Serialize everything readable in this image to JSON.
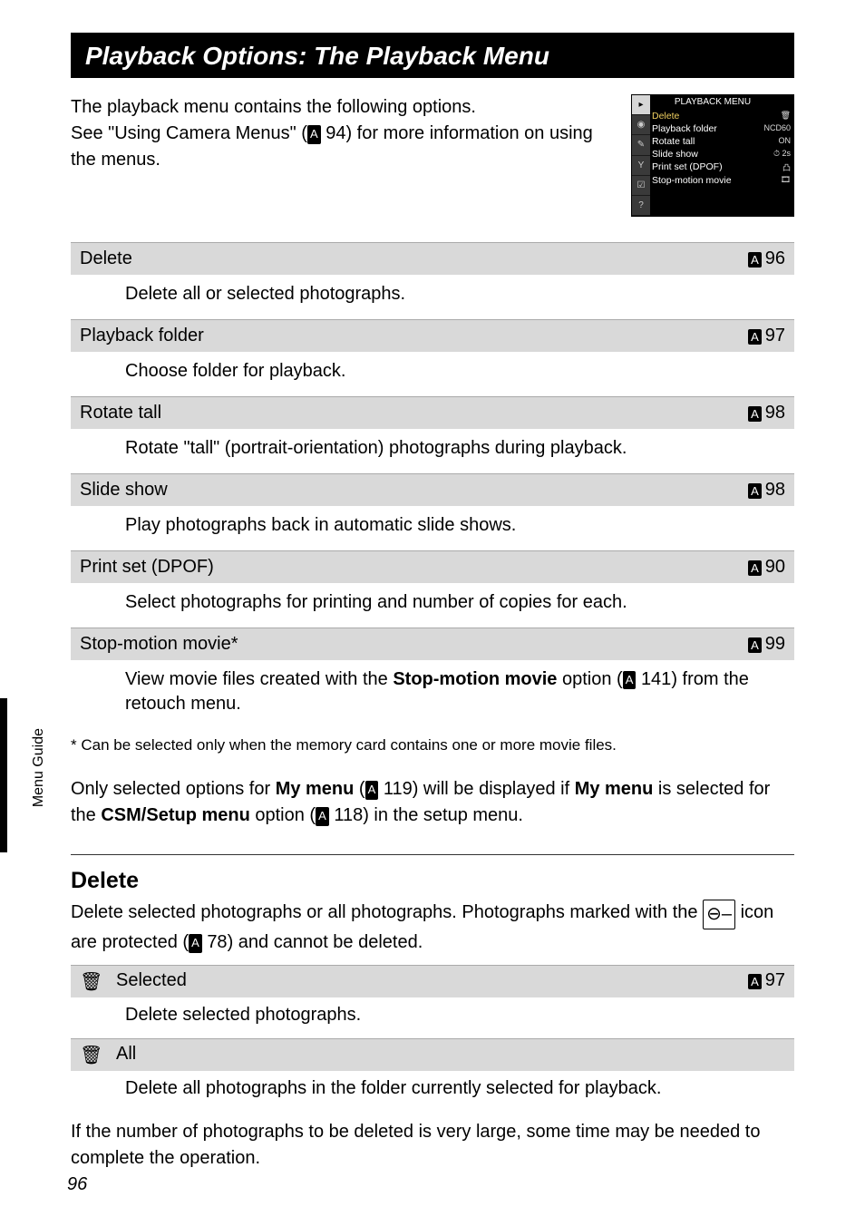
{
  "header": {
    "title": "Playback Options: The Playback Menu"
  },
  "intro": {
    "line1": "The playback menu contains the following options.",
    "line2a": "See \"Using Camera Menus\" (",
    "line2_ref": "94",
    "line2b": ") for more information on using the menus."
  },
  "screenThumb": {
    "title": "PLAYBACK MENU",
    "rows": [
      {
        "label": "Delete",
        "right": "🗑"
      },
      {
        "label": "Playback folder",
        "right": "NCD60"
      },
      {
        "label": "Rotate tall",
        "right": "ON"
      },
      {
        "label": "Slide show",
        "right": "⏱ 2s"
      },
      {
        "label": "Print set (DPOF)",
        "right": "凸"
      },
      {
        "label": "Stop-motion movie",
        "right": "🎞"
      }
    ]
  },
  "menu": [
    {
      "title": "Delete",
      "ref": "96",
      "desc": "Delete all or selected photographs."
    },
    {
      "title": "Playback folder",
      "ref": "97",
      "desc": "Choose folder for playback."
    },
    {
      "title": "Rotate tall",
      "ref": "98",
      "desc": "Rotate \"tall\" (portrait-orientation) photographs during playback."
    },
    {
      "title": "Slide show",
      "ref": "98",
      "desc": "Play photographs back in automatic slide shows."
    },
    {
      "title": "Print set (DPOF)",
      "ref": "90",
      "desc": "Select photographs for printing and number of copies for each."
    },
    {
      "title": "Stop-motion movie*",
      "ref": "99",
      "desc_pre": "View movie files created with the ",
      "desc_bold": "Stop-motion movie",
      "desc_mid": " option (",
      "desc_ref": "141",
      "desc_post": ") from the retouch menu."
    }
  ],
  "footnote": "*  Can be selected only when the memory card contains one or more movie files.",
  "mymenu": {
    "pre": "Only selected options for ",
    "bold1": "My menu",
    "mid1": " (",
    "ref1": "119",
    "mid2": ") will be displayed if ",
    "bold2": "My menu",
    "mid3": " is selected for the ",
    "bold3": "CSM/Setup menu",
    "mid4": " option (",
    "ref2": "118",
    "post": ") in the setup menu."
  },
  "deleteSection": {
    "heading": "Delete",
    "body_pre": "Delete selected photographs or all photographs. Photographs marked with the ",
    "body_mid": " icon are protected (",
    "body_ref": "78",
    "body_post": ") and cannot be deleted.",
    "rows": [
      {
        "label": "Selected",
        "ref": "97",
        "desc": "Delete selected photographs."
      },
      {
        "label": "All",
        "ref": "",
        "desc": "Delete all photographs in the folder currently selected for playback."
      }
    ],
    "tail": "If the number of photographs to be deleted is very large, some time may be needed to complete the operation."
  },
  "sidebar": {
    "label": "Menu Guide"
  },
  "pageNumber": "96"
}
